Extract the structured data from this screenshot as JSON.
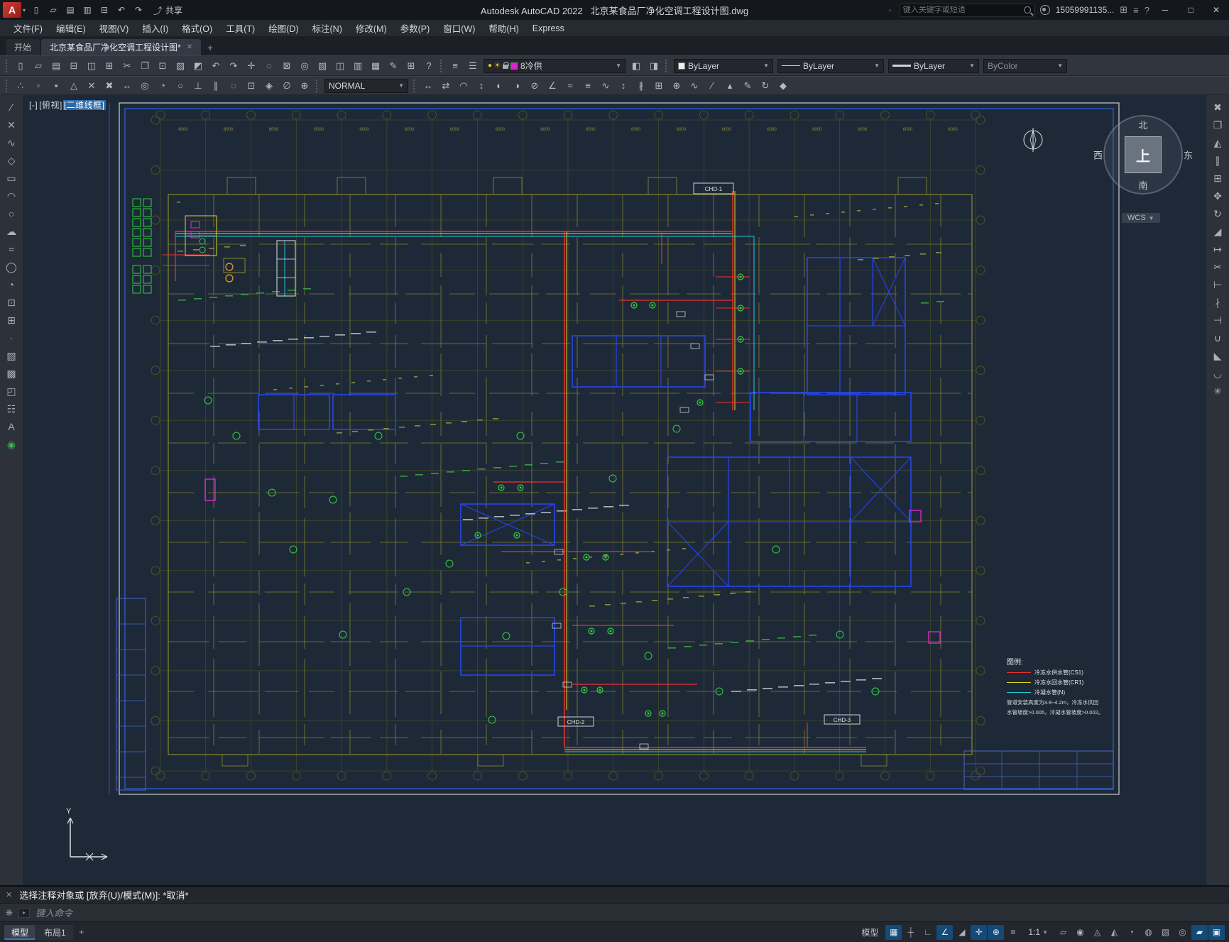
{
  "titlebar": {
    "share_label": "共享",
    "app_title": "Autodesk AutoCAD 2022",
    "doc_title": "北京某食品厂净化空调工程设计图.dwg",
    "search_placeholder": "键入关键字或短语",
    "user_name": "15059991135...",
    "qat_icons": [
      "new-file",
      "open",
      "save",
      "save-as",
      "plot",
      "undo",
      "redo"
    ]
  },
  "menubar": {
    "items": [
      "文件(F)",
      "编辑(E)",
      "视图(V)",
      "插入(I)",
      "格式(O)",
      "工具(T)",
      "绘图(D)",
      "标注(N)",
      "修改(M)",
      "参数(P)",
      "窗口(W)",
      "帮助(H)",
      "Express"
    ]
  },
  "filetabs": {
    "start_tab": "开始",
    "doc_tab": "北京某食品厂净化空调工程设计图*"
  },
  "toolbar1": {
    "icons": [
      "new-file",
      "open",
      "save",
      "plot",
      "plot-preview",
      "publish",
      "cut",
      "copy",
      "paste",
      "match-properties",
      "block-editor",
      "undo",
      "redo",
      "pan",
      "zoom-realtime",
      "zoom-window",
      "zoom-previous",
      "properties",
      "design-center",
      "tool-palettes",
      "sheet-set-manager",
      "markup",
      "quick-calc",
      "help"
    ],
    "layer_icons": [
      "layer-properties",
      "layer-states"
    ],
    "layer_combo": {
      "value": "8冷供",
      "state_icons": [
        "layer-on",
        "layer-freeze",
        "layer-lock",
        "layer-color"
      ],
      "swatch_color": "#e020d0"
    },
    "post_layer_icons": [
      "make-current",
      "layer-previous"
    ],
    "color_combo": "ByLayer",
    "linetype_combo": "ByLayer",
    "lineweight_combo": "ByLayer",
    "plotstyle_combo": "ByColor"
  },
  "toolbar2": {
    "icons_left": [
      "snap-tracking",
      "snap-from",
      "snap-endpoint",
      "snap-midpoint",
      "snap-intersection",
      "snap-apparent",
      "snap-extension",
      "snap-center",
      "snap-quadrant",
      "snap-tangent",
      "snap-perpendicular",
      "snap-parallel",
      "snap-node",
      "snap-insert",
      "snap-nearest",
      "snap-none",
      "osnap-settings"
    ],
    "style_combo": "NORMAL",
    "icons_right": [
      "linear-dim",
      "aligned-dim",
      "arc-length-dim",
      "ordinate-dim",
      "radius-dim",
      "jogged-dim",
      "diameter-dim",
      "angular-dim",
      "quick-dim",
      "baseline-dim",
      "continue-dim",
      "dim-space",
      "dim-break",
      "tolerance",
      "center-mark",
      "dim-jog",
      "dim-oblique",
      "dim-text-align",
      "dim-text-edit",
      "dim-update",
      "dim-style"
    ]
  },
  "left_toolbar": [
    "line",
    "construction-line",
    "polyline",
    "polygon",
    "rectangle",
    "arc",
    "circle",
    "revision-cloud",
    "spline",
    "ellipse",
    "ellipse-arc",
    "insert-block",
    "create-block",
    "point",
    "hatch",
    "gradient",
    "region",
    "table",
    "multiline-text",
    "point-style"
  ],
  "right_toolbar": [
    "erase",
    "copy",
    "mirror",
    "offset",
    "array",
    "move",
    "rotate",
    "scale",
    "stretch",
    "trim",
    "extend",
    "break-at-point",
    "break",
    "join",
    "chamfer",
    "fillet",
    "explode"
  ],
  "canvas": {
    "viewport_controls": [
      "[-]",
      "[俯视]",
      "[二维线框]"
    ],
    "viewcube": {
      "north": "北",
      "south": "南",
      "west": "西",
      "east": "东",
      "up": "上",
      "wcs": "WCS"
    },
    "ucs_y_label": "Y",
    "dim_label": "6000",
    "equipment_tags": [
      "CHD-1",
      "CHD-2",
      "CHD-3"
    ],
    "legend": {
      "title": "图例:",
      "items": [
        {
          "label": "冷冻水供水管(CS1)",
          "color": "#f03030"
        },
        {
          "label": "冷冻水回水管(CR1)",
          "color": "#d8d62c"
        },
        {
          "label": "冷凝水管(N)",
          "color": "#27c8d8"
        }
      ],
      "notes": [
        "管道安装高度为3.8~4.2m，冷冻水供回",
        "水管坡度>0.005，冷凝水管坡度>0.002。"
      ]
    }
  },
  "command": {
    "history": "选择注释对象或  [放弃(U)/模式(M)]: *取消*",
    "prompt": "键入命令"
  },
  "bottombar": {
    "layout_tabs": [
      "模型",
      "布局1"
    ],
    "model_label": "模型",
    "scale_label": "1:1",
    "status_icons_a": [
      {
        "name": "grid-display",
        "active": true
      },
      {
        "name": "snap-mode",
        "active": false
      },
      {
        "name": "ortho-mode",
        "active": false
      },
      {
        "name": "polar-tracking",
        "active": true
      },
      {
        "name": "isometric-drafting",
        "active": false
      },
      {
        "name": "object-snap-tracking",
        "active": true
      },
      {
        "name": "object-snap",
        "active": true
      },
      {
        "name": "lineweight-display",
        "active": false
      }
    ],
    "status_icons_b": [
      {
        "name": "transparency",
        "active": false
      },
      {
        "name": "selection-cycling",
        "active": false
      },
      {
        "name": "annotation-visibility",
        "active": false
      },
      {
        "name": "autoscale",
        "active": false
      },
      {
        "name": "annotation-monitor",
        "active": false
      },
      {
        "name": "units",
        "active": false
      },
      {
        "name": "quick-properties",
        "active": false
      },
      {
        "name": "isolate-objects",
        "active": false
      },
      {
        "name": "hardware-acceleration",
        "active": true
      },
      {
        "name": "clean-screen",
        "active": true
      }
    ]
  }
}
